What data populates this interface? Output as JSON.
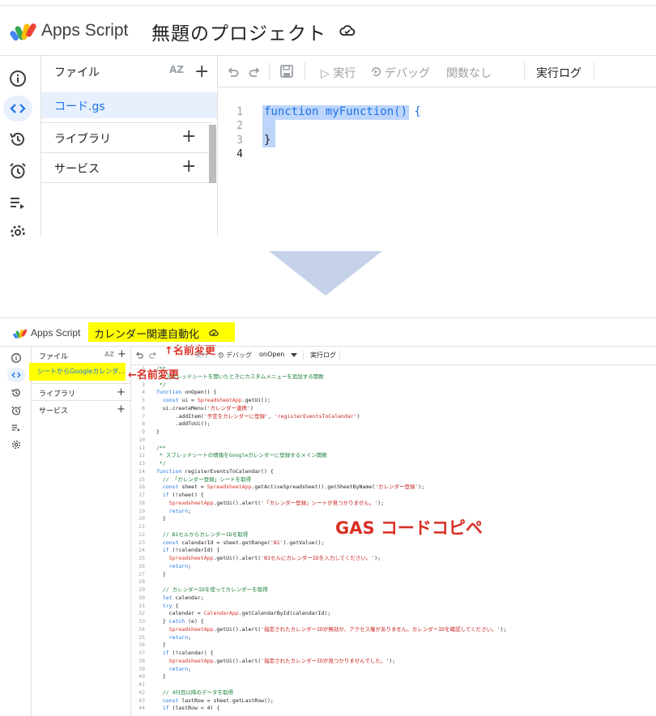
{
  "before": {
    "app_name": "Apps Script",
    "project_title": "無題のプロジェクト",
    "files_header": "ファイル",
    "sort_label": "AZ",
    "file_name": "コード.gs",
    "libraries_label": "ライブラリ",
    "services_label": "サービス",
    "toolbar": {
      "run_label": "▷ 実行",
      "debug_label": "デバッグ",
      "function_select": "関数なし",
      "exec_log_label": "実行ログ"
    },
    "code_lines": [
      {
        "n": "1",
        "t": "function myFunction() {"
      },
      {
        "n": "2",
        "t": ""
      },
      {
        "n": "3",
        "t": "}"
      },
      {
        "n": "4",
        "t": ""
      }
    ]
  },
  "after": {
    "app_name": "Apps Script",
    "project_title": "カレンダー関連自動化",
    "files_header": "ファイル",
    "sort_label": "AZ",
    "file_name": "シートからGoogleカレンダ…",
    "libraries_label": "ライブラリ",
    "services_label": "サービス",
    "toolbar": {
      "run_label": "実行",
      "debug_label": "デバッグ",
      "function_select": "onOpen",
      "exec_log_label": "実行ログ"
    },
    "annotation_title": "↑名前変更",
    "annotation_file": "←名前変更",
    "annotation_code": "GAS コードコピペ",
    "code_lines": [
      {
        "n": "1",
        "t": "/**"
      },
      {
        "n": "2",
        "t": " * スプレッドシートを開いたときにカスタムメニューを追加する関数"
      },
      {
        "n": "3",
        "t": " */"
      },
      {
        "n": "4",
        "t": "function onOpen() {"
      },
      {
        "n": "5",
        "t": "  const ui = SpreadsheetApp.getUi();"
      },
      {
        "n": "6",
        "t": "  ui.createMenu('カレンダー連携')"
      },
      {
        "n": "7",
        "t": "      .addItem('予定をカレンダーに登録', 'registerEventsToCalendar')"
      },
      {
        "n": "8",
        "t": "      .addToUi();"
      },
      {
        "n": "9",
        "t": "}"
      },
      {
        "n": "10",
        "t": ""
      },
      {
        "n": "11",
        "t": "/**"
      },
      {
        "n": "12",
        "t": " * スプレッドシートの情報をGoogleカレンダーに登録するメイン関数"
      },
      {
        "n": "13",
        "t": " */"
      },
      {
        "n": "14",
        "t": "function registerEventsToCalendar() {"
      },
      {
        "n": "15",
        "t": "  // 「カレンダー登録」シートを取得"
      },
      {
        "n": "16",
        "t": "  const sheet = SpreadsheetApp.getActiveSpreadsheet().getSheetByName('カレンダー登録');"
      },
      {
        "n": "17",
        "t": "  if (!sheet) {"
      },
      {
        "n": "18",
        "t": "    SpreadsheetApp.getUi().alert('「カレンダー登録」シートが見つかりません。');"
      },
      {
        "n": "19",
        "t": "    return;"
      },
      {
        "n": "20",
        "t": "  }"
      },
      {
        "n": "21",
        "t": ""
      },
      {
        "n": "22",
        "t": "  // B1セルからカレンダーIDを取得"
      },
      {
        "n": "23",
        "t": "  const calendarId = sheet.getRange('B1').getValue();"
      },
      {
        "n": "24",
        "t": "  if (!calendarId) {"
      },
      {
        "n": "25",
        "t": "    SpreadsheetApp.getUi().alert('B1セルにカレンダーIDを入力してください。');"
      },
      {
        "n": "26",
        "t": "    return;"
      },
      {
        "n": "27",
        "t": "  }"
      },
      {
        "n": "28",
        "t": ""
      },
      {
        "n": "29",
        "t": "  // カレンダーIDを使ってカレンダーを取得"
      },
      {
        "n": "30",
        "t": "  let calendar;"
      },
      {
        "n": "31",
        "t": "  try {"
      },
      {
        "n": "32",
        "t": "    calendar = CalendarApp.getCalendarById(calendarId);"
      },
      {
        "n": "33",
        "t": "  } catch (e) {"
      },
      {
        "n": "34",
        "t": "    SpreadsheetApp.getUi().alert('指定されたカレンダーIDが無効か、アクセス権がありません。カレンダーIDを確認してください。');"
      },
      {
        "n": "35",
        "t": "    return;"
      },
      {
        "n": "36",
        "t": "  }"
      },
      {
        "n": "37",
        "t": "  if (!calendar) {"
      },
      {
        "n": "38",
        "t": "    SpreadsheetApp.getUi().alert('指定されたカレンダーIDが見つかりませんでした。');"
      },
      {
        "n": "39",
        "t": "    return;"
      },
      {
        "n": "40",
        "t": "  }"
      },
      {
        "n": "41",
        "t": ""
      },
      {
        "n": "42",
        "t": "  // 4行目以降のデータを取得"
      },
      {
        "n": "43",
        "t": "  const lastRow = sheet.getLastRow();"
      },
      {
        "n": "44",
        "t": "  if (lastRow < 4) {"
      }
    ]
  },
  "colors": {
    "accent": "#1a73e8",
    "selection": "#a8c7fa",
    "highlight": "#ffff00",
    "annotation": "#d93025",
    "arrow": "#c5d2ea",
    "comment": "#188038",
    "string": "#c5221f",
    "class": "#d93025"
  }
}
